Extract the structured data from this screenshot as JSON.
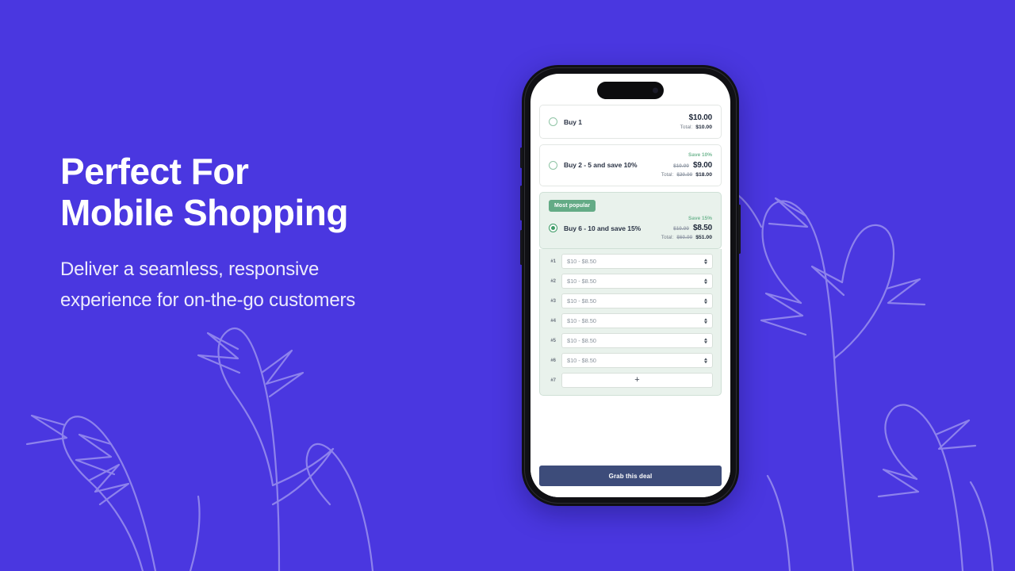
{
  "theme": {
    "background": "#4a37e0",
    "accent_green": "#64ab86",
    "cta_color": "#3d4c7a",
    "text_on_dark": "#ffffff"
  },
  "hero": {
    "headline_line1": "Perfect For",
    "headline_line2": "Mobile Shopping",
    "subcopy_line1": "Deliver a seamless, responsive",
    "subcopy_line2": "experience for on-the-go customers"
  },
  "phone": {
    "island_label": "dynamic-island",
    "offers": [
      {
        "title": "Buy 1",
        "selected": false,
        "badge": null,
        "save_tag": null,
        "price_old": null,
        "price_new": "$10.00",
        "total_label": "Total:",
        "total_old": null,
        "total_new": "$10.00"
      },
      {
        "title": "Buy 2 - 5 and save 10%",
        "selected": false,
        "badge": null,
        "save_tag": "Save 10%",
        "price_old": "$10.00",
        "price_new": "$9.00",
        "total_label": "Total:",
        "total_old": "$20.00",
        "total_new": "$18.00"
      },
      {
        "title": "Buy 6 - 10 and save 15%",
        "selected": true,
        "badge": "Most popular",
        "save_tag": "Save 15%",
        "price_old": "$10.00",
        "price_new": "$8.50",
        "total_label": "Total:",
        "total_old": "$60.00",
        "total_new": "$51.00"
      }
    ],
    "quantity_rows": [
      {
        "index": "#1",
        "value": "$10 - $8.50",
        "is_add": false
      },
      {
        "index": "#2",
        "value": "$10 - $8.50",
        "is_add": false
      },
      {
        "index": "#3",
        "value": "$10 - $8.50",
        "is_add": false
      },
      {
        "index": "#4",
        "value": "$10 - $8.50",
        "is_add": false
      },
      {
        "index": "#5",
        "value": "$10 - $8.50",
        "is_add": false
      },
      {
        "index": "#6",
        "value": "$10 - $8.50",
        "is_add": false
      },
      {
        "index": "#7",
        "value": "+",
        "is_add": true
      }
    ],
    "cta_label": "Grab this deal"
  }
}
